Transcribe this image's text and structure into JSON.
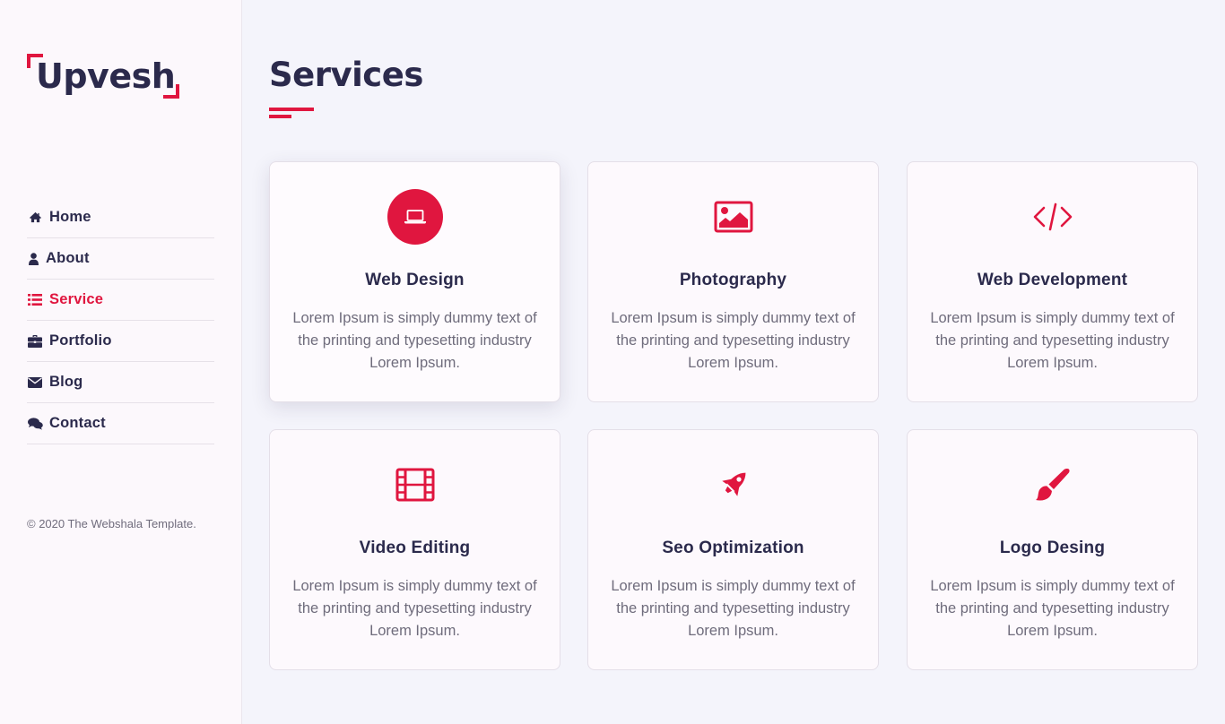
{
  "brand": {
    "name": "Upvesh",
    "accent_color": "#e0163f",
    "text_color": "#2b2a4c"
  },
  "nav": {
    "items": [
      {
        "label": "Home",
        "icon": "home-icon",
        "active": false
      },
      {
        "label": "About",
        "icon": "user-icon",
        "active": false
      },
      {
        "label": "Service",
        "icon": "list-icon",
        "active": true
      },
      {
        "label": "Portfolio",
        "icon": "briefcase-icon",
        "active": false
      },
      {
        "label": "Blog",
        "icon": "envelope-icon",
        "active": false
      },
      {
        "label": "Contact",
        "icon": "comments-icon",
        "active": false
      }
    ]
  },
  "footer": {
    "copyright": "© 2020 The Webshala Template."
  },
  "page": {
    "title": "Services"
  },
  "services": [
    {
      "title": "Web Design",
      "icon": "laptop-icon",
      "text": "Lorem Ipsum is simply dummy text of the printing and typesetting industry Lorem Ipsum."
    },
    {
      "title": "Photography",
      "icon": "image-icon",
      "text": "Lorem Ipsum is simply dummy text of the printing and typesetting industry Lorem Ipsum."
    },
    {
      "title": "Web Development",
      "icon": "code-icon",
      "text": "Lorem Ipsum is simply dummy text of the printing and typesetting industry Lorem Ipsum."
    },
    {
      "title": "Video Editing",
      "icon": "film-icon",
      "text": "Lorem Ipsum is simply dummy text of the printing and typesetting industry Lorem Ipsum."
    },
    {
      "title": "Seo Optimization",
      "icon": "rocket-icon",
      "text": "Lorem Ipsum is simply dummy text of the printing and typesetting industry Lorem Ipsum."
    },
    {
      "title": "Logo Desing",
      "icon": "paint-brush-icon",
      "text": "Lorem Ipsum is simply dummy text of the printing and typesetting industry Lorem Ipsum."
    }
  ]
}
